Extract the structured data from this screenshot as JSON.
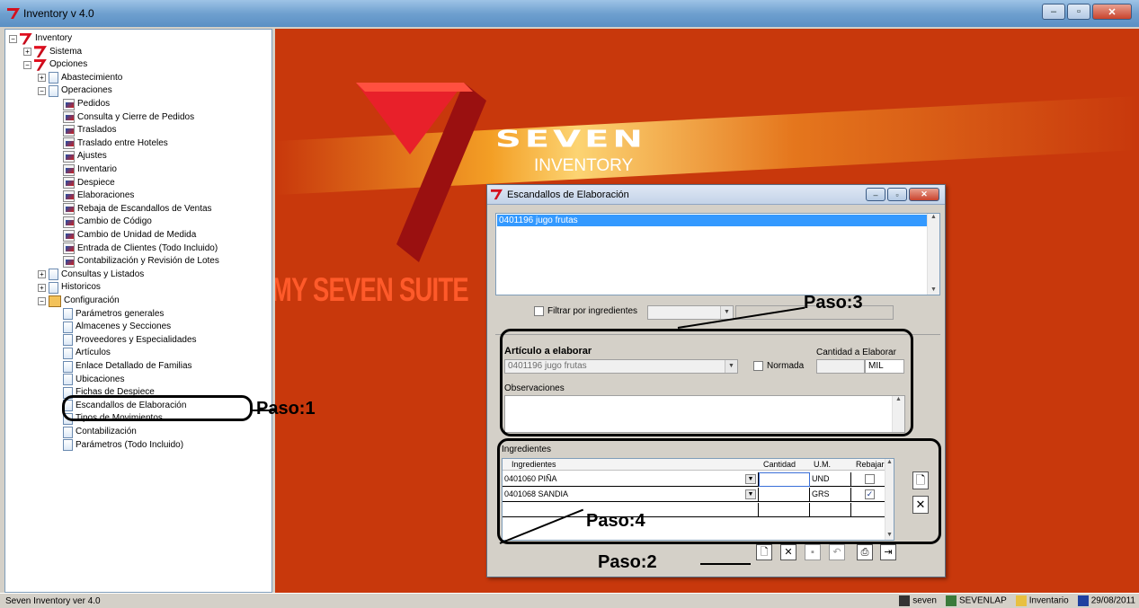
{
  "window": {
    "title": "Inventory v 4.0"
  },
  "tree": {
    "items": [
      {
        "label": "Inventory",
        "level": 0,
        "icon": "seven",
        "exp": "−"
      },
      {
        "label": "Sistema",
        "level": 1,
        "icon": "seven",
        "exp": "+"
      },
      {
        "label": "Opciones",
        "level": 1,
        "icon": "seven",
        "exp": "−"
      },
      {
        "label": "Abastecimiento",
        "level": 2,
        "icon": "doc",
        "exp": "+"
      },
      {
        "label": "Operaciones",
        "level": 2,
        "icon": "doc",
        "exp": "−"
      },
      {
        "label": "Pedidos",
        "level": 3,
        "icon": "form"
      },
      {
        "label": "Consulta y Cierre de Pedidos",
        "level": 3,
        "icon": "form"
      },
      {
        "label": "Traslados",
        "level": 3,
        "icon": "form"
      },
      {
        "label": "Traslado entre Hoteles",
        "level": 3,
        "icon": "form"
      },
      {
        "label": "Ajustes",
        "level": 3,
        "icon": "form"
      },
      {
        "label": "Inventario",
        "level": 3,
        "icon": "form"
      },
      {
        "label": "Despiece",
        "level": 3,
        "icon": "form"
      },
      {
        "label": "Elaboraciones",
        "level": 3,
        "icon": "form"
      },
      {
        "label": "Rebaja de Escandallos de Ventas",
        "level": 3,
        "icon": "form"
      },
      {
        "label": "Cambio de Código",
        "level": 3,
        "icon": "form"
      },
      {
        "label": "Cambio de Unidad de Medida",
        "level": 3,
        "icon": "form"
      },
      {
        "label": "Entrada de Clientes (Todo Incluido)",
        "level": 3,
        "icon": "form"
      },
      {
        "label": "Contabilización y Revisión de Lotes",
        "level": 3,
        "icon": "form"
      },
      {
        "label": "Consultas y Listados",
        "level": 2,
        "icon": "doc",
        "exp": "+"
      },
      {
        "label": "Historicos",
        "level": 2,
        "icon": "doc",
        "exp": "+"
      },
      {
        "label": "Configuración",
        "level": 2,
        "icon": "cfg",
        "exp": "−"
      },
      {
        "label": "Parámetros generales",
        "level": 3,
        "icon": "doc"
      },
      {
        "label": "Almacenes y Secciones",
        "level": 3,
        "icon": "doc"
      },
      {
        "label": "Proveedores y Especialidades",
        "level": 3,
        "icon": "doc"
      },
      {
        "label": "Artículos",
        "level": 3,
        "icon": "doc"
      },
      {
        "label": "Enlace Detallado de Familias",
        "level": 3,
        "icon": "doc"
      },
      {
        "label": "Ubicaciones",
        "level": 3,
        "icon": "doc"
      },
      {
        "label": "Fichas de Despiece",
        "level": 3,
        "icon": "doc"
      },
      {
        "label": "Escandallos de Elaboración",
        "level": 3,
        "icon": "doc"
      },
      {
        "label": "Tipos de Movimientos",
        "level": 3,
        "icon": "doc"
      },
      {
        "label": "Contabilización",
        "level": 3,
        "icon": "doc"
      },
      {
        "label": "Parámetros (Todo Incluido)",
        "level": 3,
        "icon": "doc"
      }
    ]
  },
  "branding": {
    "name": "SEVEN",
    "product": "INVENTORY",
    "suite": "MY SEVEN SUITE",
    "accent": "#c8380c"
  },
  "dialog": {
    "title": "Escandallos de Elaboración",
    "list_selected": "0401196 jugo frutas",
    "filter_label": "Filtrar por ingredientes",
    "articulo_label": "Artículo a elaborar",
    "articulo_value": "0401196 jugo frutas",
    "normada_label": "Normada",
    "cantidad_label": "Cantidad a Elaborar",
    "cantidad_unit": "MIL",
    "observaciones_label": "Observaciones",
    "ingredientes_label": "Ingredientes",
    "grid_headers": {
      "ingredientes": "Ingredientes",
      "cantidad": "Cantidad",
      "um": "U.M.",
      "rebajar": "Rebajar"
    },
    "rows": [
      {
        "ingrediente": "0401060 PIÑA",
        "cantidad": "",
        "um": "UND",
        "rebajar": false
      },
      {
        "ingrediente": "0401068 SANDIA",
        "cantidad": "",
        "um": "GRS",
        "rebajar": true
      }
    ]
  },
  "annotations": {
    "paso1": "Paso:1",
    "paso2": "Paso:2",
    "paso3": "Paso:3",
    "paso4": "Paso:4"
  },
  "status": {
    "left": "Seven Inventory ver 4.0",
    "user": "seven",
    "machine": "SEVENLAP",
    "db": "Inventario",
    "date": "29/08/2011"
  }
}
